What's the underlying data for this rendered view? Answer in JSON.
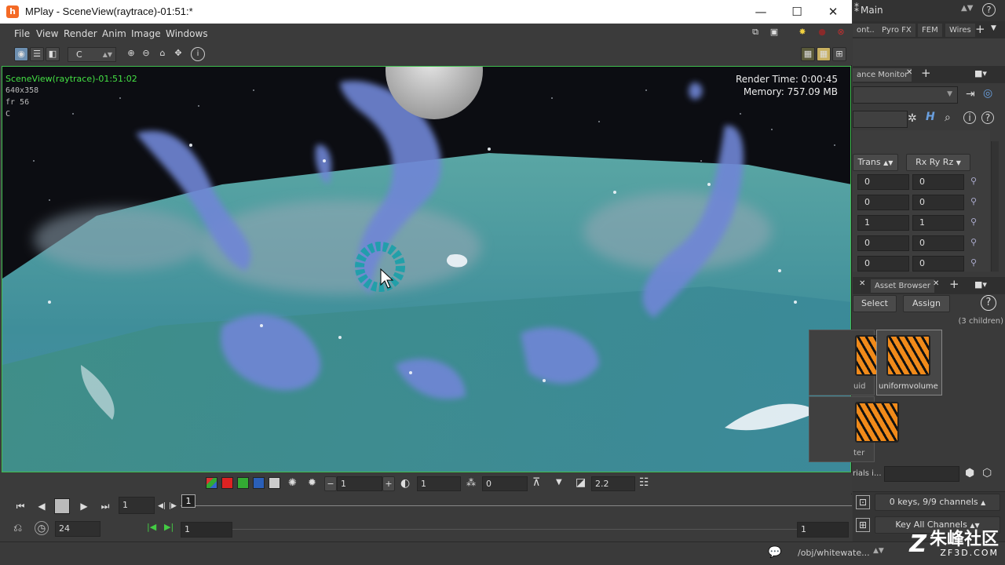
{
  "window": {
    "title": "MPlay - SceneView(raytrace)-01:51:*",
    "minimize": "—",
    "maximize": "☐",
    "close": "✕"
  },
  "menu": [
    "File",
    "View",
    "Render",
    "Anim",
    "Image",
    "Windows"
  ],
  "toolbar": {
    "plane": "C"
  },
  "viewport": {
    "name": "SceneView(raytrace)-01:51:02",
    "resolution": "640x358",
    "frame": "fr 56",
    "plane": "C",
    "render_time": "Render Time: 0:00:45",
    "memory": "Memory:   757.09 MB"
  },
  "colorbar": {
    "lut_value": "1",
    "gamma_value": "1",
    "exposure_value": "0",
    "display_gamma": "2.2"
  },
  "playbar": {
    "current_frame": "1",
    "timeline_frame": "1"
  },
  "rangebar": {
    "fps": "24",
    "start": "1",
    "end": "1"
  },
  "right_panel": {
    "desktop": "Main",
    "shelf_tabs": [
      "ont..",
      "Pyro FX",
      "FEM",
      "Wires"
    ],
    "monitor_tab": "ance Monitor",
    "xform_header": [
      "Trans",
      "Rx Ry Rz"
    ],
    "xform_rows": [
      [
        "0",
        "0"
      ],
      [
        "0",
        "0"
      ],
      [
        "1",
        "1"
      ],
      [
        "0",
        "0"
      ],
      [
        "0",
        "0"
      ]
    ],
    "asset_tab": "Asset Browser",
    "select_label": "Select",
    "assign_label": "Assign",
    "children": "(3 children)",
    "nodes": [
      "uid",
      "uniformvolume",
      "ter"
    ],
    "materials_label": "rials i...",
    "keys_label": "0 keys, 9/9 channels",
    "key_all": "Key All Channels"
  },
  "statusbar": {
    "path": "/obj/whitewate..."
  },
  "watermark": {
    "brand": "朱峰社区",
    "site": "ZF3D.COM"
  }
}
